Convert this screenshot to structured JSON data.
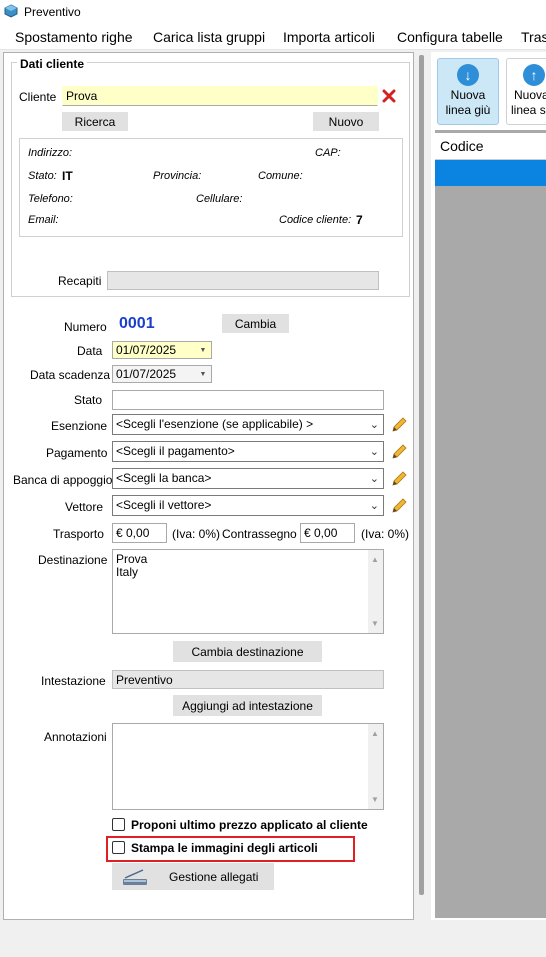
{
  "window": {
    "title": "Preventivo"
  },
  "menu": [
    "Spostamento righe",
    "Carica lista gruppi",
    "Importa articoli",
    "Configura tabelle",
    "Tras"
  ],
  "cliente_group": {
    "title": "Dati cliente",
    "cliente_label": "Cliente",
    "cliente_value": "Prova",
    "ricerca": "Ricerca",
    "nuovo": "Nuovo",
    "indirizzo": "Indirizzo:",
    "cap": "CAP:",
    "stato_label": "Stato:",
    "stato_value": "IT",
    "provincia": "Provincia:",
    "comune": "Comune:",
    "telefono": "Telefono:",
    "cellulare": "Cellulare:",
    "email": "Email:",
    "codice_label": "Codice cliente:",
    "codice_value": "7",
    "recapiti": "Recapiti"
  },
  "form": {
    "numero_label": "Numero",
    "numero_value": "0001",
    "cambia": "Cambia",
    "data_label": "Data",
    "data_value": "01/07/2025",
    "scadenza_label": "Data scadenza",
    "scadenza_value": "01/07/2025",
    "stato_label": "Stato",
    "esenzione_label": "Esenzione",
    "esenzione_value": "<Scegli l'esenzione (se applicabile) >",
    "pagamento_label": "Pagamento",
    "pagamento_value": "<Scegli il pagamento>",
    "banca_label": "Banca di appoggio",
    "banca_value": "<Scegli la banca>",
    "vettore_label": "Vettore",
    "vettore_value": "<Scegli il vettore>",
    "trasporto_label": "Trasporto",
    "trasporto_value": "€ 0,00",
    "iva1": "(Iva: 0%)",
    "contrassegno_label": "Contrassegno",
    "contrassegno_value": "€ 0,00",
    "iva2": "(Iva: 0%)",
    "destinazione_label": "Destinazione",
    "destinazione_line1": "Prova",
    "destinazione_line2": "Italy",
    "cambia_destinazione": "Cambia destinazione",
    "intestazione_label": "Intestazione",
    "intestazione_value": "Preventivo",
    "aggiungi_intestazione": "Aggiungi ad intestazione",
    "annotazioni_label": "Annotazioni",
    "proponi_label": "Proponi ultimo prezzo applicato al cliente",
    "stampa_label": "Stampa le immagini degli articoli",
    "gestione_allegati": "Gestione allegati"
  },
  "toolbar": {
    "nuova_giu_1": "Nuova",
    "nuova_giu_2": "linea giù",
    "nuova_su_1": "Nuova",
    "nuova_su_2": "linea s"
  },
  "grid": {
    "col_codice": "Codice"
  },
  "colors": {
    "accent": "#2e8fd8",
    "selection": "#0a84e0",
    "numero": "#1a3fcc",
    "highlight": "#e02020"
  }
}
